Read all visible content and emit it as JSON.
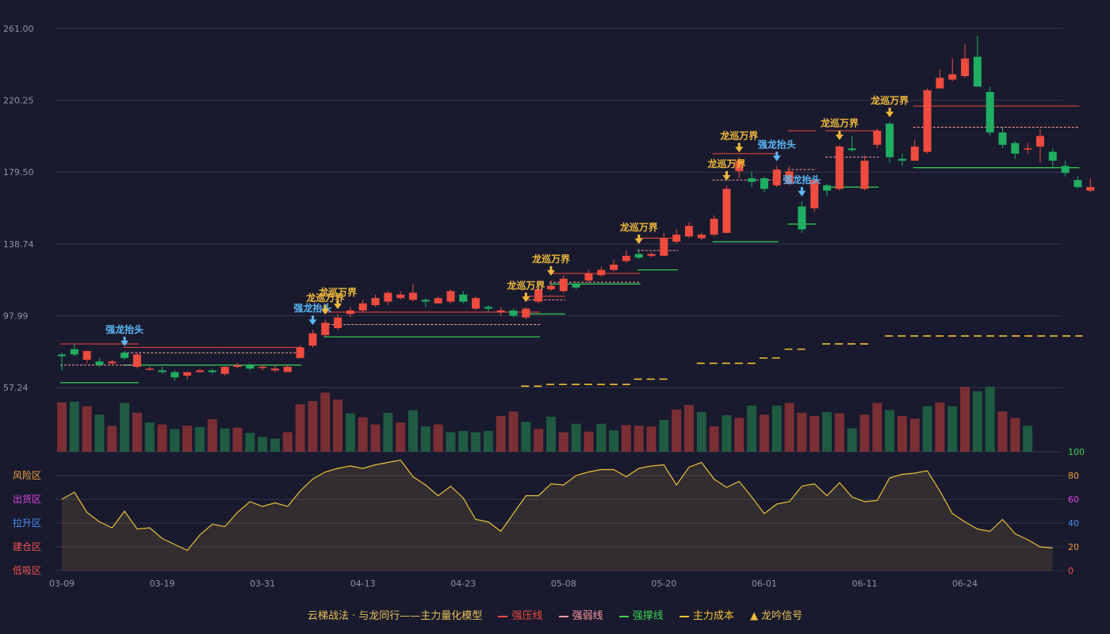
{
  "chart_data": {
    "type": "candlestick",
    "price_axis": {
      "ticks": [
        "261.00",
        "220.25",
        "179.50",
        "138.74",
        "97.99",
        "57.24"
      ],
      "ylim": [
        57.24,
        261.0
      ],
      "grid": true
    },
    "x_tick_labels": [
      {
        "label": "03-09",
        "index": 0
      },
      {
        "label": "03-19",
        "index": 8
      },
      {
        "label": "03-31",
        "index": 16
      },
      {
        "label": "04-13",
        "index": 24
      },
      {
        "label": "04-23",
        "index": 32
      },
      {
        "label": "05-08",
        "index": 40
      },
      {
        "label": "05-20",
        "index": 48
      },
      {
        "label": "06-01",
        "index": 56
      },
      {
        "label": "06-11",
        "index": 64
      },
      {
        "label": "06-24",
        "index": 72
      }
    ],
    "candles": [
      [
        76,
        75,
        77,
        67
      ],
      [
        79,
        76,
        82,
        75
      ],
      [
        73,
        78,
        78,
        71
      ],
      [
        72,
        70,
        74,
        69
      ],
      [
        71,
        72,
        73,
        70
      ],
      [
        77,
        74,
        78,
        73
      ],
      [
        69,
        76,
        77,
        68
      ],
      [
        68,
        68,
        69,
        67
      ],
      [
        67,
        66,
        69,
        65
      ],
      [
        66,
        63,
        67,
        61
      ],
      [
        64,
        66,
        66,
        62
      ],
      [
        66,
        67,
        68,
        66
      ],
      [
        67,
        66,
        68,
        65
      ],
      [
        65,
        69,
        69,
        64
      ],
      [
        69,
        70,
        71,
        68
      ],
      [
        70,
        68,
        71,
        67
      ],
      [
        69,
        69,
        70,
        67
      ],
      [
        67,
        68,
        70,
        66
      ],
      [
        66,
        69,
        70,
        66
      ],
      [
        74,
        80,
        81,
        74
      ],
      [
        81,
        88,
        90,
        80
      ],
      [
        87,
        94,
        96,
        86
      ],
      [
        91,
        97,
        99,
        90
      ],
      [
        99,
        101,
        103,
        97
      ],
      [
        101,
        105,
        107,
        100
      ],
      [
        104,
        108,
        110,
        103
      ],
      [
        106,
        111,
        112,
        104
      ],
      [
        108,
        110,
        112,
        107
      ],
      [
        107,
        111,
        116,
        106
      ],
      [
        107,
        106,
        108,
        103
      ],
      [
        105,
        108,
        109,
        105
      ],
      [
        106,
        112,
        113,
        105
      ],
      [
        110,
        106,
        112,
        105
      ],
      [
        102,
        108,
        109,
        101
      ],
      [
        103,
        102,
        104,
        100
      ],
      [
        100,
        101,
        103,
        98
      ],
      [
        101,
        98,
        102,
        97
      ],
      [
        97,
        102,
        103,
        96
      ],
      [
        106,
        113,
        115,
        105
      ],
      [
        113,
        115,
        118,
        112
      ],
      [
        112,
        119,
        121,
        111
      ],
      [
        116,
        114,
        117,
        113
      ],
      [
        118,
        122,
        124,
        117
      ],
      [
        121,
        124,
        126,
        120
      ],
      [
        124,
        127,
        130,
        123
      ],
      [
        129,
        132,
        135,
        128
      ],
      [
        133,
        131,
        136,
        130
      ],
      [
        132,
        133,
        134,
        131
      ],
      [
        132,
        142,
        145,
        132
      ],
      [
        140,
        144,
        147,
        139
      ],
      [
        143,
        149,
        151,
        142
      ],
      [
        142,
        144,
        145,
        141
      ],
      [
        144,
        153,
        155,
        143
      ],
      [
        145,
        170,
        172,
        145
      ],
      [
        180,
        186,
        188,
        176
      ],
      [
        176,
        174,
        180,
        171
      ],
      [
        176,
        170,
        177,
        168
      ],
      [
        172,
        181,
        183,
        171
      ],
      [
        173,
        180,
        183,
        172
      ],
      [
        160,
        147,
        163,
        145
      ],
      [
        159,
        175,
        176,
        157
      ],
      [
        172,
        169,
        173,
        166
      ],
      [
        170,
        194,
        195,
        169
      ],
      [
        193,
        192,
        200,
        191
      ],
      [
        170,
        186,
        189,
        169
      ],
      [
        195,
        203,
        204,
        193
      ],
      [
        207,
        188,
        208,
        185
      ],
      [
        187,
        186,
        190,
        183
      ],
      [
        186,
        194,
        198,
        186
      ],
      [
        191,
        226,
        227,
        190
      ],
      [
        227,
        233,
        238,
        227
      ],
      [
        232,
        235,
        244,
        231
      ],
      [
        234,
        244,
        252,
        233
      ],
      [
        245,
        228,
        257,
        228
      ],
      [
        225,
        202,
        228,
        200
      ],
      [
        202,
        195,
        205,
        193
      ],
      [
        196,
        190,
        197,
        187
      ],
      [
        193,
        193,
        196,
        190
      ],
      [
        194,
        200,
        204,
        185
      ],
      [
        191,
        186,
        193,
        182
      ],
      [
        183,
        179,
        186,
        177
      ],
      [
        175,
        171,
        177,
        170
      ],
      [
        169,
        171,
        176,
        168
      ]
    ],
    "volume": [
      76,
      77,
      70,
      57,
      40,
      75,
      60,
      45,
      42,
      35,
      40,
      38,
      50,
      36,
      37,
      29,
      23,
      20,
      30,
      73,
      78,
      91,
      80,
      59,
      53,
      42,
      60,
      45,
      64,
      39,
      42,
      30,
      32,
      30,
      32,
      55,
      62,
      46,
      35,
      54,
      30,
      43,
      31,
      43,
      33,
      41,
      40,
      39,
      49,
      65,
      72,
      61,
      39,
      56,
      52,
      71,
      57,
      71,
      75,
      60,
      55,
      61,
      59,
      36,
      57,
      75,
      64,
      55,
      51,
      70,
      76,
      70,
      100,
      93,
      100,
      62,
      52,
      40
    ],
    "volume_up": [
      1,
      0,
      1,
      0,
      1,
      0,
      1,
      0,
      1,
      0,
      1,
      0,
      1,
      0,
      1,
      0,
      0,
      0,
      1,
      1,
      1,
      1,
      1,
      0,
      1,
      1,
      0,
      1,
      0,
      0,
      1,
      0,
      0,
      0,
      0,
      1,
      1,
      0,
      1,
      0,
      1,
      0,
      1,
      0,
      0,
      1,
      1,
      1,
      0,
      1,
      1,
      0,
      1,
      0,
      1,
      0,
      1,
      0,
      1,
      1,
      1,
      0,
      1,
      0,
      1,
      1,
      0,
      1,
      1,
      0,
      1,
      0,
      1,
      0,
      0,
      1,
      1,
      0,
      0,
      1,
      1,
      1
    ],
    "strength_line": [
      60,
      66,
      49,
      41,
      36,
      50,
      35,
      36,
      27,
      22,
      17,
      30,
      39,
      37,
      49,
      58,
      54,
      57,
      54,
      67,
      77,
      83,
      86,
      88,
      86,
      89,
      91,
      93,
      79,
      72,
      63,
      71,
      61,
      43,
      41,
      33,
      48,
      63,
      63,
      73,
      72,
      80,
      83,
      85,
      85,
      79,
      86,
      88,
      89,
      72,
      87,
      91,
      77,
      70,
      75,
      62,
      48,
      56,
      58,
      71,
      73,
      63,
      74,
      62,
      58,
      59,
      78,
      81,
      82,
      84,
      67,
      48,
      41,
      35,
      33,
      43,
      31,
      26,
      20,
      19
    ],
    "oscillator_axis": {
      "ticks": [
        "100",
        "80",
        "60",
        "40",
        "20",
        "0"
      ],
      "ylim": [
        0,
        100
      ]
    },
    "zones": [
      {
        "label": "风险区",
        "color": "#f2a33a"
      },
      {
        "label": "出货区",
        "color": "#e046e6"
      },
      {
        "label": "拉升区",
        "color": "#4f8ff7"
      },
      {
        "label": "建仓区",
        "color": "#ef5350"
      },
      {
        "label": "低吸区",
        "color": "#ef5350"
      }
    ],
    "pressure_lines": [
      [
        0,
        6,
        82.0
      ],
      [
        5,
        19,
        80.0
      ],
      [
        21,
        38,
        100.0
      ],
      [
        37,
        40,
        109.0
      ],
      [
        39,
        46,
        122.0
      ],
      [
        46,
        49,
        142.0
      ],
      [
        52,
        57,
        190.0
      ],
      [
        58,
        60,
        203.0
      ],
      [
        61,
        65,
        203.0
      ],
      [
        68,
        81,
        217.0
      ]
    ],
    "weak_lines": [
      [
        0,
        6,
        70.0
      ],
      [
        5,
        19,
        77.0
      ],
      [
        21,
        38,
        93.0
      ],
      [
        37,
        40,
        107.0
      ],
      [
        39,
        46,
        117.0
      ],
      [
        46,
        49,
        135.0
      ],
      [
        52,
        57,
        175.0
      ],
      [
        58,
        60,
        181.0
      ],
      [
        61,
        65,
        188.0
      ],
      [
        68,
        81,
        205.0
      ]
    ],
    "support_lines": [
      [
        0,
        6,
        60.0
      ],
      [
        5,
        19,
        70.0
      ],
      [
        21,
        38,
        86.0
      ],
      [
        37,
        40,
        99.0
      ],
      [
        39,
        46,
        116.0
      ],
      [
        46,
        49,
        124.0
      ],
      [
        52,
        57,
        140.0
      ],
      [
        58,
        60,
        150.0
      ],
      [
        61,
        65,
        171.0
      ],
      [
        68,
        81,
        182.0
      ]
    ],
    "cost_segments": [
      [
        37,
        38,
        58.0
      ],
      [
        39,
        45,
        59.0
      ],
      [
        46,
        48,
        62.0
      ],
      [
        51,
        55,
        71.0
      ],
      [
        56,
        57,
        74.0
      ],
      [
        58,
        59,
        79.0
      ],
      [
        61,
        64,
        82.0
      ],
      [
        66,
        81,
        86.5
      ]
    ],
    "signals": [
      {
        "index": 5,
        "label": "强龙抬头",
        "color": "#5ab8f5",
        "tier": 0
      },
      {
        "index": 20,
        "label": "强龙抬头",
        "color": "#5ab8f5",
        "tier": 0
      },
      {
        "index": 21,
        "label": "龙巡万界",
        "color": "#f0b93a",
        "tier": 0
      },
      {
        "index": 22,
        "label": "龙巡万界",
        "color": "#f0b93a",
        "tier": 1
      },
      {
        "index": 37,
        "label": "龙巡万界",
        "color": "#f0b93a",
        "tier": 0
      },
      {
        "index": 39,
        "label": "龙巡万界",
        "color": "#f0b93a",
        "tier": 1
      },
      {
        "index": 46,
        "label": "龙巡万界",
        "color": "#f0b93a",
        "tier": 0
      },
      {
        "index": 53,
        "label": "龙巡万界",
        "color": "#f0b93a",
        "tier": 0
      },
      {
        "index": 54,
        "label": "龙巡万界",
        "color": "#f0b93a",
        "tier": 1
      },
      {
        "index": 57,
        "label": "强龙抬头",
        "color": "#5ab8f5",
        "tier": 0
      },
      {
        "index": 59,
        "label": "强龙抬头",
        "color": "#5ab8f5",
        "tier": 0
      },
      {
        "index": 62,
        "label": "龙巡万界",
        "color": "#f0b93a",
        "tier": 0
      },
      {
        "index": 66,
        "label": "龙巡万界",
        "color": "#f0b93a",
        "tier": 0
      }
    ],
    "colors": {
      "up": "#ef4b3f",
      "down": "#1fae62",
      "vol_up": "#7a2f35",
      "vol_down": "#1f5a42",
      "pressure": "#ef4b3f",
      "weak": "#ff9aa2",
      "support": "#39d353",
      "cost": "#f2c230",
      "strength": "#e7c23b",
      "grid": "#34364c",
      "axis_text": "#8f93a8"
    }
  },
  "legend": {
    "model_name": "云梯战法 · 与龙同行——主力量化模型",
    "pressure": "强压线",
    "weak": "强弱线",
    "support": "强撑线",
    "cost": "主力成本",
    "signal": "龙吟信号",
    "signal_glyph": "▲"
  }
}
